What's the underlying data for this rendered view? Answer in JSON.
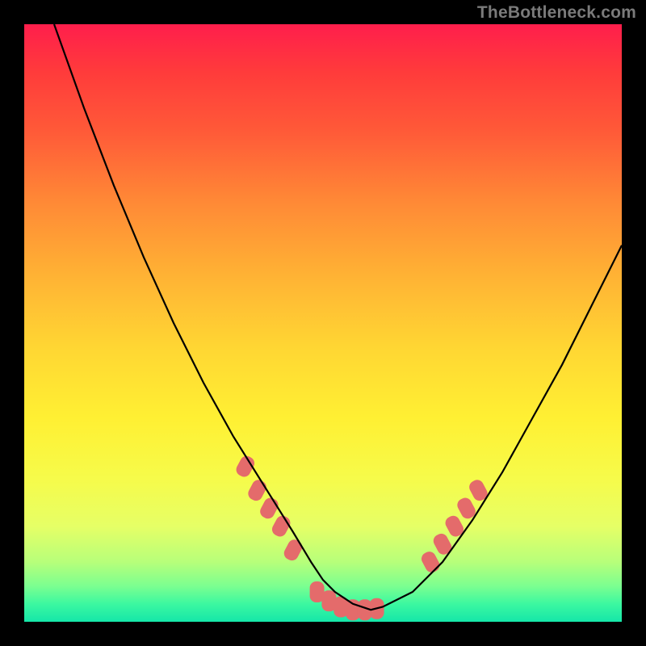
{
  "watermark": "TheBottleneck.com",
  "chart_data": {
    "type": "line",
    "title": "",
    "xlabel": "",
    "ylabel": "",
    "xlim": [
      0,
      100
    ],
    "ylim": [
      0,
      100
    ],
    "grid": false,
    "legend": false,
    "series": [
      {
        "name": "curve",
        "color": "#000000",
        "x": [
          5,
          10,
          15,
          20,
          25,
          30,
          35,
          40,
          45,
          48,
          50,
          52,
          55,
          58,
          60,
          65,
          70,
          75,
          80,
          85,
          90,
          95,
          100
        ],
        "values": [
          100,
          86,
          73,
          61,
          50,
          40,
          31,
          23,
          15,
          10,
          7,
          5,
          3,
          2,
          2.5,
          5,
          10,
          17,
          25,
          34,
          43,
          53,
          63
        ]
      }
    ],
    "markers": [
      {
        "name": "segment",
        "x": 37,
        "y": 26,
        "color": "#e46b6b"
      },
      {
        "name": "segment",
        "x": 39,
        "y": 22,
        "color": "#e46b6b"
      },
      {
        "name": "segment",
        "x": 41,
        "y": 19,
        "color": "#e46b6b"
      },
      {
        "name": "segment",
        "x": 43,
        "y": 16,
        "color": "#e46b6b"
      },
      {
        "name": "segment",
        "x": 45,
        "y": 12,
        "color": "#e46b6b"
      },
      {
        "name": "segment",
        "x": 49,
        "y": 5,
        "color": "#e46b6b"
      },
      {
        "name": "segment",
        "x": 51,
        "y": 3.5,
        "color": "#e46b6b"
      },
      {
        "name": "segment",
        "x": 53,
        "y": 2.5,
        "color": "#e46b6b"
      },
      {
        "name": "segment",
        "x": 55,
        "y": 2,
        "color": "#e46b6b"
      },
      {
        "name": "segment",
        "x": 57,
        "y": 2,
        "color": "#e46b6b"
      },
      {
        "name": "segment",
        "x": 59,
        "y": 2.2,
        "color": "#e46b6b"
      },
      {
        "name": "segment",
        "x": 68,
        "y": 10,
        "color": "#e46b6b"
      },
      {
        "name": "segment",
        "x": 70,
        "y": 13,
        "color": "#e46b6b"
      },
      {
        "name": "segment",
        "x": 72,
        "y": 16,
        "color": "#e46b6b"
      },
      {
        "name": "segment",
        "x": 74,
        "y": 19,
        "color": "#e46b6b"
      },
      {
        "name": "segment",
        "x": 76,
        "y": 22,
        "color": "#e46b6b"
      }
    ]
  }
}
